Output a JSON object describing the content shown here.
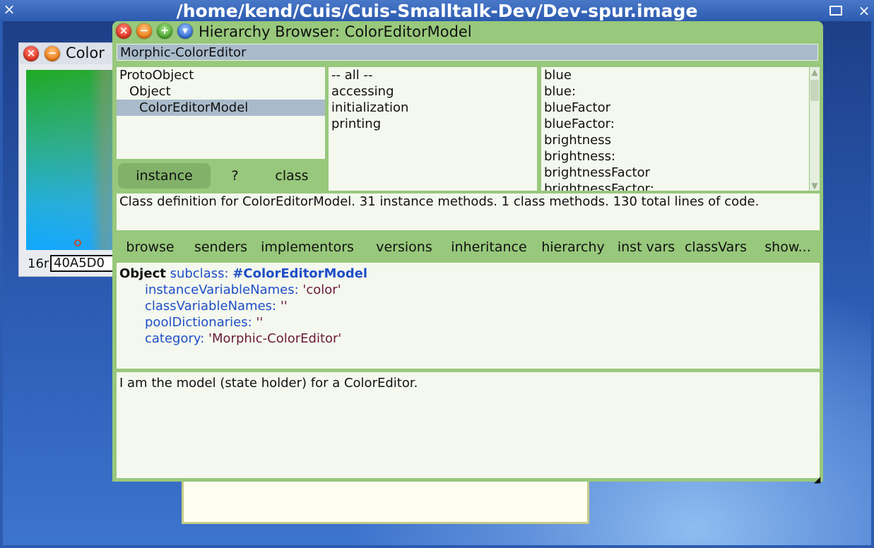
{
  "os_window": {
    "title": "/home/kend/Cuis/Cuis-Smalltalk-Dev/Dev-spur.image",
    "close_glyph": "×",
    "maximize_icon": "maximize-icon",
    "close_icon": "close-icon"
  },
  "color_editor": {
    "title": "Color",
    "close_glyph": "×",
    "minimize_glyph": "−",
    "hex_label": "16r",
    "hex_value": "40A5D0"
  },
  "browser": {
    "title": "Hierarchy Browser: ColorEditorModel",
    "buttons": {
      "close": "×",
      "minimize": "−",
      "expand": "+",
      "menu": "▾"
    },
    "category": "Morphic-ColorEditor",
    "classes": [
      "ProtoObject",
      "Object",
      "ColorEditorModel"
    ],
    "selected_class": "ColorEditorModel",
    "toggles": {
      "instance": "instance",
      "help": "?",
      "class": "class"
    },
    "method_categories": [
      "-- all --",
      "accessing",
      "initialization",
      "printing"
    ],
    "methods": [
      "blue",
      "blue:",
      "blueFactor",
      "blueFactor:",
      "brightness",
      "brightness:",
      "brightnessFactor",
      "brightnessFactor:"
    ],
    "info": "Class definition for ColorEditorModel. 31 instance methods. 1 class methods. 130 total lines of code.",
    "toolbar": {
      "browse": "browse",
      "senders": "senders",
      "implementors": "implementors",
      "versions": "versions",
      "inheritance": "inheritance",
      "hierarchy": "hierarchy",
      "inst_vars": "inst vars",
      "class_vars": "classVars",
      "show": "show..."
    },
    "definition": {
      "superclass": "Object",
      "subclass_kw": "subclass:",
      "class_symbol": "#ColorEditorModel",
      "inst_vars_kw": "instanceVariableNames:",
      "inst_vars_val": "'color'",
      "class_vars_kw": "classVariableNames:",
      "class_vars_val": "''",
      "pool_kw": "poolDictionaries:",
      "pool_val": "''",
      "category_kw": "category:",
      "category_val": "'Morphic-ColorEditor'"
    },
    "comment": "I am the model (state holder) for a ColorEditor."
  }
}
